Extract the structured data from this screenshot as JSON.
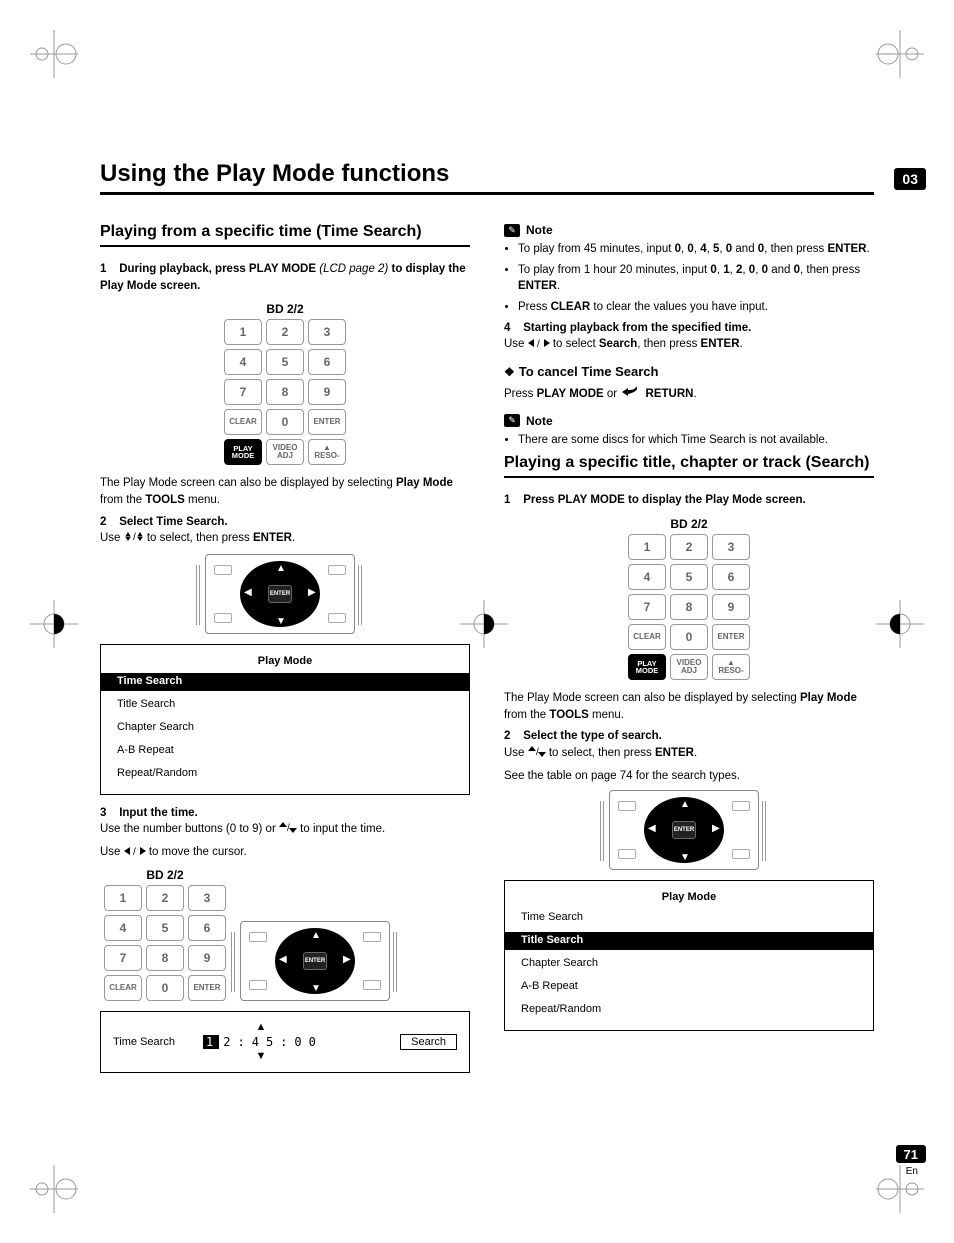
{
  "page": {
    "chapter_tab": "03",
    "number": "71",
    "lang": "En"
  },
  "h1": "Using the Play Mode functions",
  "left": {
    "h2": "Playing from a specific time (Time Search)",
    "step1_num": "1",
    "step1_bold_a": "During playback, press PLAY MODE",
    "step1_italic": "(LCD page 2)",
    "step1_bold_b": "to display the Play Mode screen.",
    "keypad_title": "BD  2/2",
    "keypad": [
      "1",
      "2",
      "3",
      "4",
      "5",
      "6",
      "7",
      "8",
      "9",
      "CLEAR",
      "0",
      "ENTER",
      "PLAY\nMODE",
      "VIDEO\nADJ",
      "▲\nRESO-"
    ],
    "after_keypad_a": "The Play Mode screen can also be displayed by selecting ",
    "after_keypad_b": "Play Mode",
    "after_keypad_c": " from the ",
    "after_keypad_d": "TOOLS",
    "after_keypad_e": " menu.",
    "step2_num": "2",
    "step2_bold": "Select Time Search.",
    "step2_text_a": "Use ",
    "step2_text_b": " to select, then press ",
    "step2_text_c": "ENTER",
    "step2_text_d": ".",
    "menu_title": "Play Mode",
    "menu_items": [
      "Time Search",
      "Title Search",
      "Chapter Search",
      "A-B Repeat",
      "Repeat/Random"
    ],
    "menu_selected": "Time Search",
    "step3_num": "3",
    "step3_bold": "Input the time.",
    "step3_line1_a": "Use the number buttons (0 to 9) or ",
    "step3_line1_b": " to input the time.",
    "step3_line2_a": "Use ",
    "step3_line2_b": " to move the cursor.",
    "keypad2_title": "BD  2/2",
    "keypad2": [
      "1",
      "2",
      "3",
      "4",
      "5",
      "6",
      "7",
      "8",
      "9",
      "CLEAR",
      "0",
      "ENTER"
    ],
    "time_box": {
      "label": "Time Search",
      "digits": [
        "1",
        "2",
        ":",
        "4",
        "5",
        ":",
        "0",
        "0"
      ],
      "selected_index": 0,
      "button": "Search"
    }
  },
  "right": {
    "note1_items": [
      {
        "pre": "To play from 45 minutes, input ",
        "keys": [
          "0",
          "0",
          "4",
          "5",
          "0",
          "0"
        ],
        "post": ", then press ",
        "bold": "ENTER",
        "post2": "."
      },
      {
        "pre": "To play from 1 hour 20 minutes, input ",
        "keys": [
          "0",
          "1",
          "2",
          "0",
          "0",
          "0"
        ],
        "post": ", then press ",
        "bold": "ENTER",
        "post2": "."
      },
      {
        "pre": "Press ",
        "bold": "CLEAR",
        "post": " to clear the values you have input."
      }
    ],
    "note_label": "Note",
    "step4_num": "4",
    "step4_bold": "Starting playback from the specified time.",
    "step4_text_a": "Use ",
    "step4_text_b": " to select ",
    "step4_text_c": "Search",
    "step4_text_d": ", then press ",
    "step4_text_e": "ENTER",
    "step4_text_f": ".",
    "cancel_title": "To cancel Time Search",
    "cancel_text_a": "Press ",
    "cancel_text_b": "PLAY MODE",
    "cancel_text_c": " or",
    "cancel_text_d": "RETURN",
    "cancel_text_e": ".",
    "note2_items": [
      "There are some discs for which Time Search is not available."
    ],
    "h2": "Playing a specific title, chapter or track (Search)",
    "step1_num": "1",
    "step1_bold": "Press PLAY MODE to display the Play Mode screen.",
    "keypad_title": "BD  2/2",
    "keypad": [
      "1",
      "2",
      "3",
      "4",
      "5",
      "6",
      "7",
      "8",
      "9",
      "CLEAR",
      "0",
      "ENTER",
      "PLAY\nMODE",
      "VIDEO\nADJ",
      "▲\nRESO-"
    ],
    "after_keypad_a": "The Play Mode screen can also be displayed by selecting ",
    "after_keypad_b": "Play Mode",
    "after_keypad_c": " from the ",
    "after_keypad_d": "TOOLS",
    "after_keypad_e": " menu.",
    "step2_num": "2",
    "step2_bold": "Select the type of search.",
    "step2_text_a": "Use ",
    "step2_text_b": " to select, then press ",
    "step2_text_c": "ENTER",
    "step2_text_d": ".",
    "step2_extra": "See the table on page 74 for the search types.",
    "menu_title": "Play Mode",
    "menu_items": [
      "Time Search",
      "Title Search",
      "Chapter Search",
      "A-B Repeat",
      "Repeat/Random"
    ],
    "menu_selected": "Title Search"
  },
  "icons": {
    "up_down": "↑/↓",
    "left_right": "←/→",
    "enter": "ENTER"
  }
}
